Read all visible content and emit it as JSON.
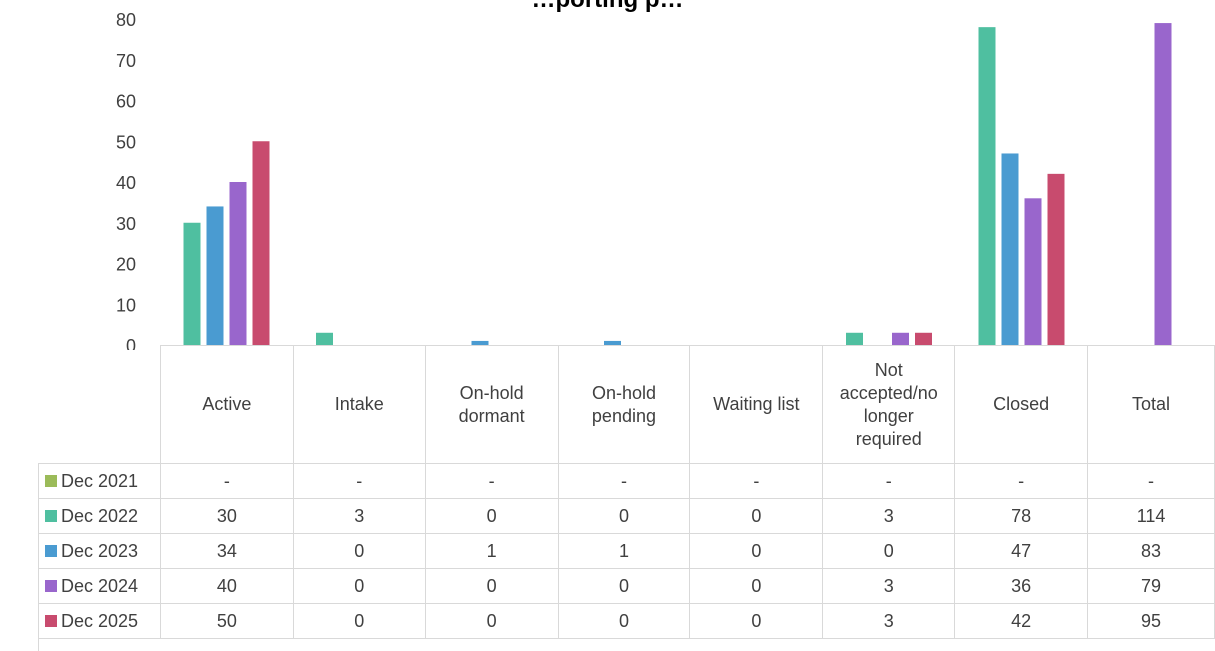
{
  "chart_data": {
    "type": "bar",
    "title": "…porting p…",
    "categories": [
      "Active",
      "Intake",
      "On-hold dormant",
      "On-hold pending",
      "Waiting list",
      "Not accepted/no longer required",
      "Closed",
      "Total"
    ],
    "category_lines": [
      [
        "Active"
      ],
      [
        "Intake"
      ],
      [
        "On-hold",
        "dormant"
      ],
      [
        "On-hold",
        "pending"
      ],
      [
        "Waiting list"
      ],
      [
        "Not",
        "accepted/no",
        "longer",
        "required"
      ],
      [
        "Closed"
      ],
      [
        "Total"
      ]
    ],
    "ylim": [
      0,
      80
    ],
    "yticks": [
      0,
      10,
      20,
      30,
      40,
      50,
      60,
      70,
      80
    ],
    "grid": false,
    "series": [
      {
        "name": "Dec 2021",
        "color": "#9bbb59",
        "values": [
          null,
          null,
          null,
          null,
          null,
          null,
          null,
          null
        ],
        "labels": [
          "-",
          "-",
          "-",
          "-",
          "-",
          "-",
          "-",
          "-"
        ]
      },
      {
        "name": "Dec 2022",
        "color": "#4fbfa0",
        "values": [
          30,
          3,
          0,
          0,
          0,
          3,
          78,
          114
        ],
        "labels": [
          "30",
          "3",
          "0",
          "0",
          "0",
          "3",
          "78",
          "114"
        ]
      },
      {
        "name": "Dec 2023",
        "color": "#4a9bd1",
        "values": [
          34,
          0,
          1,
          1,
          0,
          0,
          47,
          83
        ],
        "labels": [
          "34",
          "0",
          "1",
          "1",
          "0",
          "0",
          "47",
          "83"
        ]
      },
      {
        "name": "Dec 2024",
        "color": "#9966cc",
        "values": [
          40,
          0,
          0,
          0,
          0,
          3,
          36,
          79
        ],
        "labels": [
          "40",
          "0",
          "0",
          "0",
          "0",
          "3",
          "36",
          "79"
        ]
      },
      {
        "name": "Dec 2025",
        "color": "#c84b6e",
        "values": [
          50,
          0,
          0,
          0,
          0,
          3,
          42,
          95
        ],
        "labels": [
          "50",
          "0",
          "0",
          "0",
          "0",
          "3",
          "42",
          "95"
        ]
      }
    ]
  }
}
